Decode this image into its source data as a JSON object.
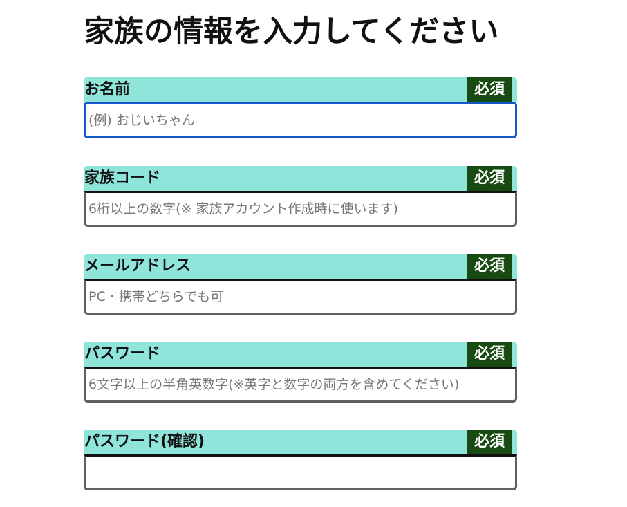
{
  "page": {
    "title": "家族の情報を入力してください"
  },
  "form": {
    "fields": [
      {
        "label": "お名前",
        "badge": "必須",
        "placeholder": "(例) おじいちゃん",
        "value": ""
      },
      {
        "label": "家族コード",
        "badge": "必須",
        "placeholder": "6桁以上の数字(※ 家族アカウント作成時に使います)",
        "value": ""
      },
      {
        "label": "メールアドレス",
        "badge": "必須",
        "placeholder": "PC・携帯どちらでも可",
        "value": ""
      },
      {
        "label": "パスワード",
        "badge": "必須",
        "placeholder": "6文字以上の半角英数字(※英字と数字の両方を含めてください)",
        "value": ""
      },
      {
        "label": "パスワード(確認)",
        "badge": "必須",
        "placeholder": "",
        "value": ""
      }
    ]
  },
  "colors": {
    "header_background": "#8fe5da",
    "badge_background": "#174b12",
    "badge_text": "#ffffff",
    "focus_border": "#1557c8",
    "input_border": "#5f5f5f"
  }
}
